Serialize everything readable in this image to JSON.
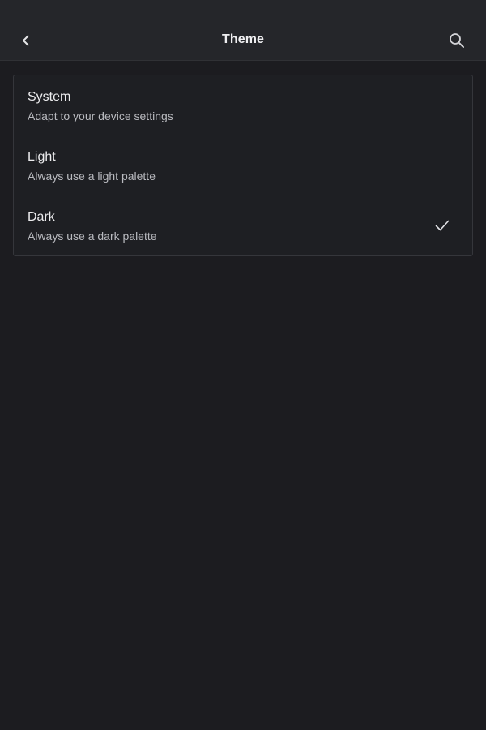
{
  "header": {
    "title": "Theme",
    "back_icon": "chevron-left-icon",
    "search_icon": "search-icon"
  },
  "theme_options": [
    {
      "label": "System",
      "description": "Adapt to your device settings",
      "selected": false
    },
    {
      "label": "Light",
      "description": "Always use a light palette",
      "selected": false
    },
    {
      "label": "Dark",
      "description": "Always use a dark palette",
      "selected": true
    }
  ],
  "colors": {
    "background": "#1c1c20",
    "app_bar": "#25262a",
    "card_border": "#35363b",
    "text_primary": "#ececee",
    "text_secondary": "#b9babf"
  }
}
